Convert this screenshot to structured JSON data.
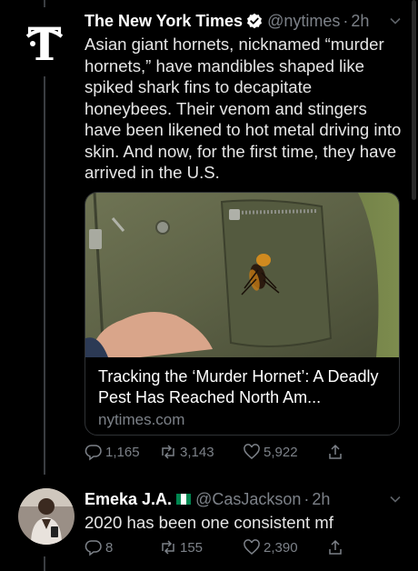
{
  "tweets": [
    {
      "author_name": "The New York Times",
      "handle": "@nytimes",
      "time": "2h",
      "text": "Asian giant hornets, nicknamed “murder hornets,” have mandibles shaped like spiked shark fins to decapitate honeybees. Their venom and stingers have been likened to hot metal driving into skin. And now, for the first time, they have arrived in the U.S.",
      "card": {
        "title": "Tracking the ‘Murder Hornet’: A Deadly Pest Has Reached North Am...",
        "domain": "nytimes.com"
      },
      "stats": {
        "replies": "1,165",
        "retweets": "3,143",
        "likes": "5,922"
      }
    },
    {
      "author_name": "Emeka J.A.",
      "handle": "@CasJackson",
      "time": "2h",
      "text": "2020 has been one consistent mf",
      "stats": {
        "replies": "8",
        "retweets": "155",
        "likes": "2,390"
      }
    }
  ],
  "separator": "·",
  "colors": {
    "background": "#000000",
    "secondary_text": "#7c8188",
    "flag_green": "#008751",
    "verified": "#ffffff"
  },
  "icons": [
    "nyt-logo",
    "verified-badge-icon",
    "chevron-down-icon",
    "reply-icon",
    "retweet-icon",
    "like-icon",
    "share-icon",
    "nigeria-flag-icon"
  ]
}
